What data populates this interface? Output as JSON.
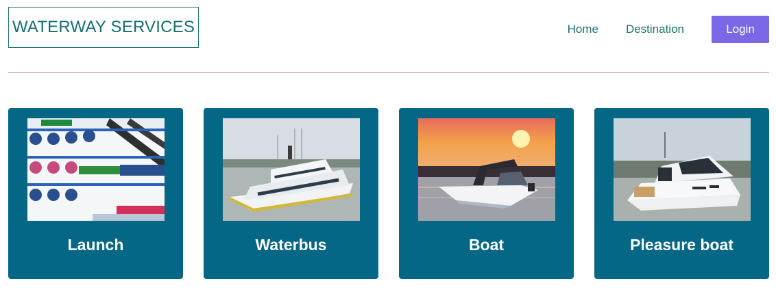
{
  "brand": {
    "title": "WATERWAY SERVICES"
  },
  "nav": {
    "home_label": "Home",
    "destination_label": "Destination",
    "login_label": "Login"
  },
  "colors": {
    "brand_teal": "#146d70",
    "login_purple": "#7b68e6",
    "card_blue": "#036785",
    "divider": "#b98a94"
  },
  "cards": [
    {
      "title": "Launch",
      "image": "launch-photo"
    },
    {
      "title": "Waterbus",
      "image": "waterbus-photo"
    },
    {
      "title": "Boat",
      "image": "boat-photo"
    },
    {
      "title": "Pleasure boat",
      "image": "pleasure-boat-photo"
    }
  ]
}
